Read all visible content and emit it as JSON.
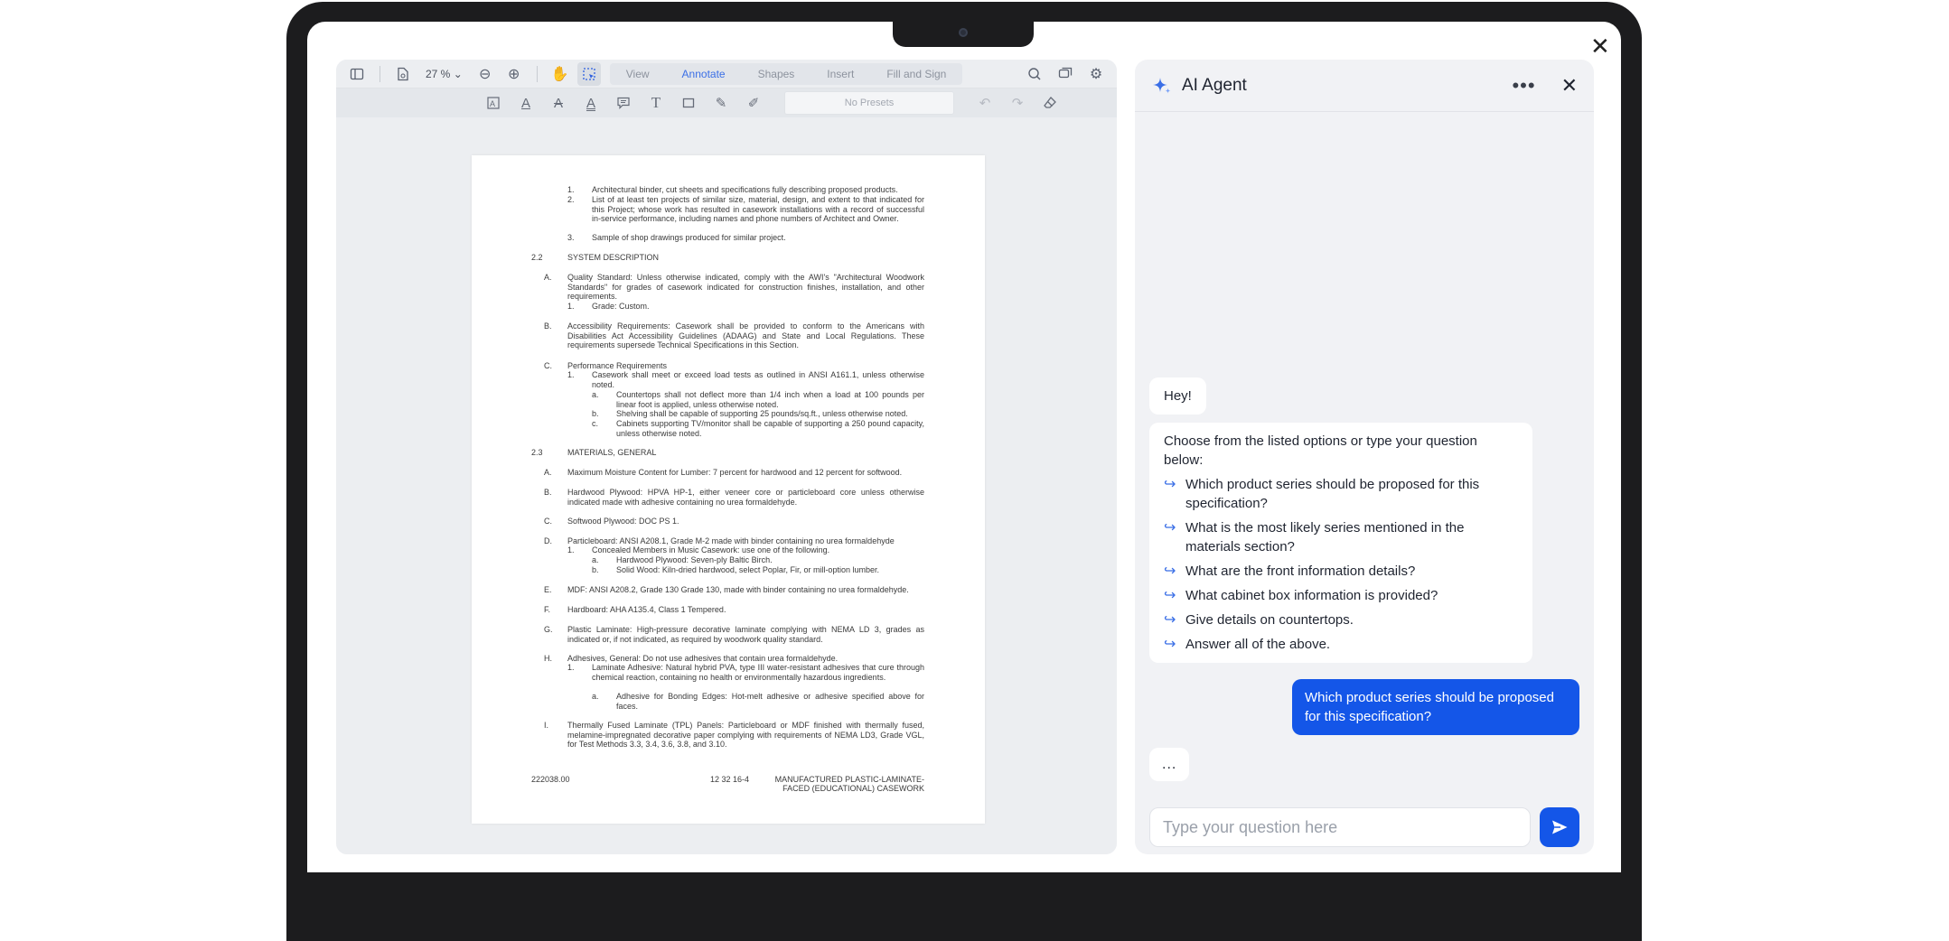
{
  "viewer": {
    "zoom": "27 %",
    "tabs": [
      "View",
      "Annotate",
      "Shapes",
      "Insert",
      "Fill and Sign"
    ],
    "presets": "No Presets"
  },
  "doc": {
    "l1": "1.",
    "l1t": "Architectural binder, cut sheets and specifications fully describing proposed products.",
    "l2": "2.",
    "l2t": "List of at least ten projects of similar size, material, design, and extent to that indicated for this Project; whose work has resulted in casework installations with a record of successful in-service performance, including names and phone numbers of Architect and Owner.",
    "l3": "3.",
    "l3t": "Sample of shop drawings produced for similar project.",
    "s22": "2.2",
    "s22t": "SYSTEM DESCRIPTION",
    "aA": "A.",
    "aAt": "Quality Standard:  Unless otherwise indicated, comply with the AWI's \"Architectural Woodwork Standards\" for grades of casework indicated for construction finishes, installation, and other requirements.",
    "aA1": "1.",
    "aA1t": "Grade:  Custom.",
    "aB": "B.",
    "aBt": "Accessibility Requirements:  Casework shall be provided to conform to the Americans with Disabilities Act Accessibility Guidelines (ADAAG) and State and Local Regulations.  These requirements supersede Technical Specifications in this Section.",
    "aC": "C.",
    "aCt": "Performance Requirements",
    "aC1": "1.",
    "aC1t": "Casework shall meet or exceed load tests as outlined in ANSI A161.1, unless otherwise noted.",
    "aCa": "a.",
    "aCat": "Countertops shall not deflect more than 1/4 inch when a load at 100 pounds per linear foot is applied, unless otherwise noted.",
    "aCb": "b.",
    "aCbt": "Shelving shall be capable of supporting 25 pounds/sq.ft., unless otherwise noted.",
    "aCc": "c.",
    "aCct": "Cabinets supporting TV/monitor shall be capable of supporting a 250 pound capacity, unless otherwise noted.",
    "s23": "2.3",
    "s23t": "MATERIALS, GENERAL",
    "mA": "A.",
    "mAt": "Maximum Moisture Content for Lumber:  7 percent for hardwood and 12 percent for softwood.",
    "mB": "B.",
    "mBt": "Hardwood Plywood:  HPVA HP-1, either veneer core or particleboard core unless otherwise indicated made with adhesive containing no urea formaldehyde.",
    "mC": "C.",
    "mCt": "Softwood Plywood:  DOC PS 1.",
    "mD": "D.",
    "mDt": "Particleboard:  ANSI A208.1, Grade M-2 made with binder containing no urea formaldehyde",
    "mD1": "1.",
    "mD1t": "Concealed Members in Music Casework:  use one of the following.",
    "mDa": "a.",
    "mDat": "Hardwood Plywood:  Seven-ply Baltic Birch.",
    "mDb": "b.",
    "mDbt": "Solid Wood:  Kiln-dried hardwood, select Poplar, Fir, or mill-option lumber.",
    "mE": "E.",
    "mEt": "MDF:  ANSI A208.2, Grade 130 Grade 130, made with binder containing no urea formaldehyde.",
    "mF": "F.",
    "mFt": "Hardboard:  AHA A135.4, Class 1 Tempered.",
    "mG": "G.",
    "mGt": "Plastic Laminate:  High-pressure decorative laminate complying with NEMA LD 3, grades as indicated or, if not indicated, as required by woodwork quality standard.",
    "mH": "H.",
    "mHt": "Adhesives, General:  Do not use adhesives that contain urea formaldehyde.",
    "mH1": "1.",
    "mH1t": "Laminate Adhesive:  Natural hybrid PVA, type III water-resistant adhesives that cure through chemical reaction, containing no health or environmentally hazardous ingredients.",
    "mHa": "a.",
    "mHat": "Adhesive for Bonding Edges:  Hot-melt adhesive or adhesive specified above for faces.",
    "mI": "I.",
    "mIt": "Thermally Fused Laminate (TPL) Panels:  Particleboard or MDF finished with thermally fused, melamine-impregnated decorative paper complying with requirements of NEMA LD3, Grade VGL, for Test Methods 3.3, 3.4, 3.6, 3.8, and 3.10.",
    "footer_left": "222038.00",
    "footer_mid": "12 32 16-4",
    "footer_right1": "MANUFACTURED PLASTIC-LAMINATE-",
    "footer_right2": "FACED (EDUCATIONAL) CASEWORK"
  },
  "chat": {
    "title": "AI Agent",
    "greeting": "Hey!",
    "intro": "Choose from the listed options or type your question below:",
    "options": [
      "Which product series should be proposed for this specification?",
      "What is the most likely series mentioned in the materials section?",
      "What are the front information details?",
      "What cabinet box information is provided?",
      "Give details on countertops.",
      "Answer all of the above."
    ],
    "user_message": "Which product series should be proposed for this specification?",
    "typing": "...",
    "input_placeholder": "Type your question here"
  },
  "colors": {
    "accent": "#1456e8",
    "frame": "#1c1c1e"
  }
}
